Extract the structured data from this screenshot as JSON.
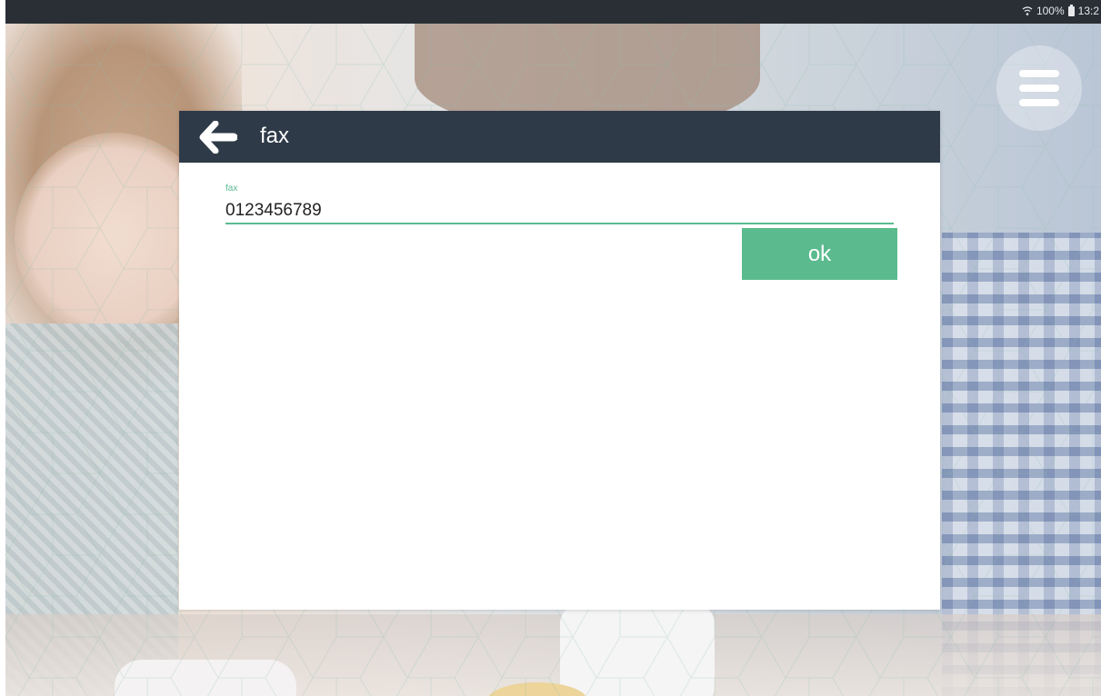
{
  "status_bar": {
    "battery": "100%",
    "time": "13:2"
  },
  "dialog": {
    "title": "fax",
    "field": {
      "label": "fax",
      "value": "0123456789"
    },
    "ok_label": "ok"
  },
  "colors": {
    "header_bg": "#2f3a48",
    "accent": "#5bbb8e",
    "status_bar_bg": "#2a2f36"
  },
  "icons": {
    "back": "arrow-left-icon",
    "menu": "hamburger-menu-icon",
    "wifi": "wifi-icon",
    "battery": "battery-icon"
  }
}
